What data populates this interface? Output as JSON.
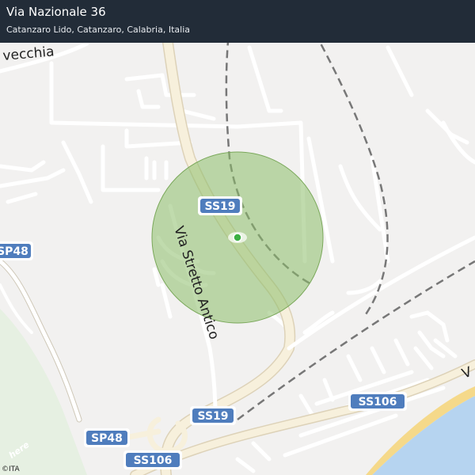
{
  "header": {
    "title": "Via Nazionale 36",
    "subtitle": "Catanzaro Lido, Catanzaro, Calabria, Italia"
  },
  "map": {
    "road_labels": {
      "vecchia": "vecchia",
      "via_stretto_antico": "Via Stretto Antico"
    },
    "shields": {
      "ss19_top": "SS19",
      "ss19_bottom": "SS19",
      "sp48_left": "SP48",
      "sp48_bottom": "SP48",
      "ss106_right": "SS106",
      "ss106_bottom": "SS106"
    },
    "logo": "here",
    "attribution": "©ITA",
    "colors": {
      "header_bg": "#222c38",
      "land": "#f2f1f0",
      "sea": "#b6d4f0",
      "beach": "#f5d98a",
      "green_area": "#e6f0e2",
      "road": "#ffffff",
      "main_road": "#f7f0dc",
      "shield_bg": "#4f7dbd",
      "accuracy_circle": "#8dbd6a",
      "location_dot": "#3cb043"
    }
  }
}
